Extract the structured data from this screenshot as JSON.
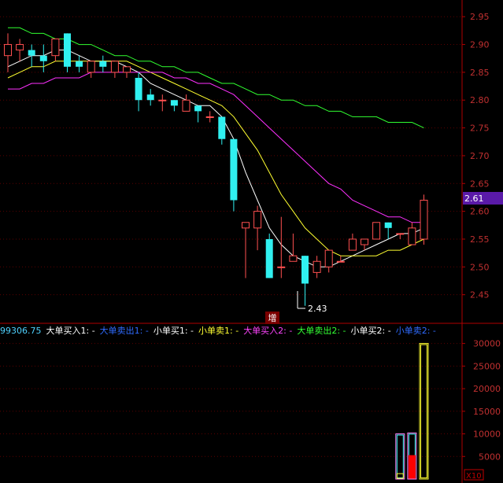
{
  "price_panel": {
    "y_ticks": [
      "2.95",
      "2.90",
      "2.85",
      "2.80",
      "2.75",
      "2.70",
      "2.65",
      "2.60",
      "2.55",
      "2.50",
      "2.45"
    ],
    "current_price_label": "2.61",
    "low_label": "2.43",
    "event_marker": "增"
  },
  "indicator_bar": {
    "items": [
      {
        "text": "99306.75",
        "color": "#4fd2ff"
      },
      {
        "text": "大单买入1: -",
        "color": "#ffffff"
      },
      {
        "text": "大单卖出1: -",
        "color": "#2f6bff"
      },
      {
        "text": "小单买1: -",
        "color": "#ffffff"
      },
      {
        "text": "小单卖1: -",
        "color": "#ffff33"
      },
      {
        "text": "大单买入2: -",
        "color": "#ff44ff"
      },
      {
        "text": "大单卖出2: -",
        "color": "#33ff33"
      },
      {
        "text": "小单买2: -",
        "color": "#ffffff"
      },
      {
        "text": "小单卖2: -",
        "color": "#2f6bff"
      }
    ]
  },
  "volume_panel": {
    "y_ticks": [
      "30000",
      "25000",
      "20000",
      "15000",
      "10000",
      "5000"
    ],
    "scale_label": "X10"
  },
  "colors": {
    "up": "#ff5050",
    "down": "#30f0f0",
    "ma_white": "#ffffff",
    "ma_yellow": "#ffff30",
    "ma_magenta": "#ff30ff",
    "ma_green": "#30ff30",
    "axis_red": "#b00000",
    "label_bg": "#5a1aa8"
  },
  "chart_data": {
    "type": "candlestick",
    "candles": [
      {
        "o": 2.88,
        "h": 2.92,
        "l": 2.85,
        "c": 2.9
      },
      {
        "o": 2.89,
        "h": 2.91,
        "l": 2.87,
        "c": 2.9
      },
      {
        "o": 2.89,
        "h": 2.9,
        "l": 2.86,
        "c": 2.88
      },
      {
        "o": 2.88,
        "h": 2.9,
        "l": 2.85,
        "c": 2.87
      },
      {
        "o": 2.88,
        "h": 2.91,
        "l": 2.87,
        "c": 2.91
      },
      {
        "o": 2.92,
        "h": 2.92,
        "l": 2.85,
        "c": 2.86
      },
      {
        "o": 2.87,
        "h": 2.88,
        "l": 2.85,
        "c": 2.86
      },
      {
        "o": 2.85,
        "h": 2.87,
        "l": 2.84,
        "c": 2.87
      },
      {
        "o": 2.87,
        "h": 2.88,
        "l": 2.85,
        "c": 2.86
      },
      {
        "o": 2.85,
        "h": 2.87,
        "l": 2.84,
        "c": 2.87
      },
      {
        "o": 2.85,
        "h": 2.86,
        "l": 2.84,
        "c": 2.86
      },
      {
        "o": 2.84,
        "h": 2.85,
        "l": 2.78,
        "c": 2.8
      },
      {
        "o": 2.81,
        "h": 2.82,
        "l": 2.79,
        "c": 2.8
      },
      {
        "o": 2.8,
        "h": 2.81,
        "l": 2.78,
        "c": 2.8
      },
      {
        "o": 2.8,
        "h": 2.8,
        "l": 2.78,
        "c": 2.79
      },
      {
        "o": 2.78,
        "h": 2.81,
        "l": 2.78,
        "c": 2.8
      },
      {
        "o": 2.79,
        "h": 2.79,
        "l": 2.76,
        "c": 2.78
      },
      {
        "o": 2.77,
        "h": 2.78,
        "l": 2.76,
        "c": 2.77
      },
      {
        "o": 2.77,
        "h": 2.77,
        "l": 2.72,
        "c": 2.73
      },
      {
        "o": 2.73,
        "h": 2.73,
        "l": 2.6,
        "c": 2.62
      },
      {
        "o": 2.57,
        "h": 2.58,
        "l": 2.48,
        "c": 2.58
      },
      {
        "o": 2.57,
        "h": 2.61,
        "l": 2.53,
        "c": 2.6
      },
      {
        "o": 2.55,
        "h": 2.56,
        "l": 2.48,
        "c": 2.48
      },
      {
        "o": 2.5,
        "h": 2.59,
        "l": 2.48,
        "c": 2.5
      },
      {
        "o": 2.51,
        "h": 2.56,
        "l": 2.51,
        "c": 2.52
      },
      {
        "o": 2.52,
        "h": 2.52,
        "l": 2.43,
        "c": 2.47
      },
      {
        "o": 2.49,
        "h": 2.52,
        "l": 2.48,
        "c": 2.51
      },
      {
        "o": 2.5,
        "h": 2.53,
        "l": 2.49,
        "c": 2.53
      },
      {
        "o": 2.51,
        "h": 2.52,
        "l": 2.51,
        "c": 2.51
      },
      {
        "o": 2.53,
        "h": 2.56,
        "l": 2.53,
        "c": 2.55
      },
      {
        "o": 2.54,
        "h": 2.55,
        "l": 2.53,
        "c": 2.55
      },
      {
        "o": 2.55,
        "h": 2.58,
        "l": 2.55,
        "c": 2.58
      },
      {
        "o": 2.58,
        "h": 2.58,
        "l": 2.55,
        "c": 2.57
      },
      {
        "o": 2.56,
        "h": 2.56,
        "l": 2.55,
        "c": 2.56
      },
      {
        "o": 2.54,
        "h": 2.58,
        "l": 2.54,
        "c": 2.57
      },
      {
        "o": 2.55,
        "h": 2.63,
        "l": 2.54,
        "c": 2.62
      }
    ],
    "ma_lines": [
      {
        "color": "#ffffff",
        "values": [
          2.86,
          2.87,
          2.88,
          2.88,
          2.89,
          2.89,
          2.88,
          2.87,
          2.87,
          2.87,
          2.86,
          2.85,
          2.83,
          2.82,
          2.81,
          2.8,
          2.79,
          2.79,
          2.77,
          2.73,
          2.67,
          2.62,
          2.57,
          2.54,
          2.52,
          2.51,
          2.5,
          2.5,
          2.51,
          2.52,
          2.53,
          2.54,
          2.55,
          2.56,
          2.56,
          2.57
        ]
      },
      {
        "color": "#ffff30",
        "values": [
          2.84,
          2.85,
          2.86,
          2.86,
          2.87,
          2.87,
          2.87,
          2.87,
          2.87,
          2.87,
          2.87,
          2.86,
          2.85,
          2.84,
          2.83,
          2.82,
          2.81,
          2.8,
          2.79,
          2.77,
          2.74,
          2.71,
          2.67,
          2.63,
          2.6,
          2.57,
          2.55,
          2.53,
          2.52,
          2.52,
          2.52,
          2.52,
          2.53,
          2.53,
          2.54,
          2.55
        ]
      },
      {
        "color": "#ff30ff",
        "values": [
          2.82,
          2.82,
          2.83,
          2.83,
          2.84,
          2.84,
          2.84,
          2.85,
          2.85,
          2.85,
          2.85,
          2.85,
          2.85,
          2.85,
          2.84,
          2.84,
          2.83,
          2.83,
          2.82,
          2.81,
          2.79,
          2.77,
          2.75,
          2.73,
          2.71,
          2.69,
          2.67,
          2.65,
          2.64,
          2.62,
          2.61,
          2.6,
          2.59,
          2.59,
          2.58,
          2.58
        ]
      },
      {
        "color": "#30ff30",
        "values": [
          2.93,
          2.93,
          2.92,
          2.92,
          2.91,
          2.91,
          2.9,
          2.9,
          2.89,
          2.88,
          2.88,
          2.87,
          2.87,
          2.86,
          2.86,
          2.85,
          2.85,
          2.84,
          2.83,
          2.83,
          2.82,
          2.81,
          2.81,
          2.8,
          2.8,
          2.79,
          2.79,
          2.78,
          2.78,
          2.77,
          2.77,
          2.77,
          2.76,
          2.76,
          2.76,
          2.75
        ]
      }
    ],
    "volume_bars": [
      {
        "index": 33,
        "total": 10000,
        "up_part": 1200,
        "colors": [
          "#ff88ff",
          "#40ffff",
          "#ffff30"
        ]
      },
      {
        "index": 34,
        "total": 10200,
        "up_part": 5200,
        "colors": [
          "#ff88ff",
          "#40ffff",
          "#ff0000"
        ]
      },
      {
        "index": 35,
        "total": 30000,
        "up_part": 0,
        "colors": [
          "#ffff30",
          "#ffff30",
          "#ffff30"
        ]
      }
    ],
    "price_range": [
      2.4,
      2.98
    ],
    "volume_range": [
      0,
      31500
    ]
  }
}
